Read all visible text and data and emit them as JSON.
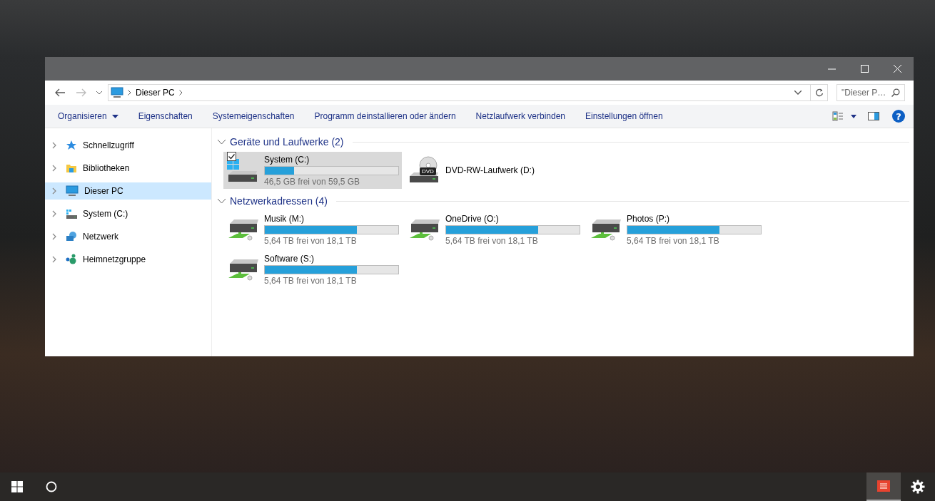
{
  "address_bar": {
    "path": [
      "Dieser PC"
    ],
    "search": {
      "placeholder": "\"Dieser P…"
    }
  },
  "help_button": {
    "label": "?"
  },
  "toolbar": {
    "items": [
      {
        "label": "Organisieren",
        "dropdown": true
      },
      {
        "label": "Eigenschaften",
        "dropdown": false
      },
      {
        "label": "Systemeigenschaften",
        "dropdown": false
      },
      {
        "label": "Programm deinstallieren oder ändern",
        "dropdown": false
      },
      {
        "label": "Netzlaufwerk verbinden",
        "dropdown": false
      },
      {
        "label": "Einstellungen öffnen",
        "dropdown": false
      }
    ]
  },
  "sidebar": {
    "items": [
      {
        "label": "Schnellzugriff",
        "kind": "star",
        "selected": false
      },
      {
        "label": "Bibliotheken",
        "kind": "library",
        "selected": false
      },
      {
        "label": "Dieser PC",
        "kind": "pc",
        "selected": true
      },
      {
        "label": "System (C:)",
        "kind": "disk",
        "selected": false
      },
      {
        "label": "Netzwerk",
        "kind": "network",
        "selected": false
      },
      {
        "label": "Heimnetzgruppe",
        "kind": "homegroup",
        "selected": false
      }
    ]
  },
  "groups": [
    {
      "title": "Geräte und Laufwerke (2)",
      "expanded": true,
      "items": [
        {
          "kind": "system",
          "name": "System (C:)",
          "level": 0.22,
          "free": "46,5 GB frei von 59,5 GB",
          "selected": true,
          "checked": true
        },
        {
          "kind": "dvd",
          "name": "DVD-RW-Laufwerk (D:)",
          "badge": "DVD",
          "selected": false,
          "checked": false
        }
      ]
    },
    {
      "title": "Netzwerkadressen (4)",
      "expanded": true,
      "items": [
        {
          "kind": "network",
          "name": "Musik (M:)",
          "level": 0.69,
          "free": "5,64 TB frei von 18,1 TB",
          "selected": false,
          "checked": false
        },
        {
          "kind": "network",
          "name": "OneDrive (O:)",
          "level": 0.69,
          "free": "5,64 TB frei von 18,1 TB",
          "selected": false,
          "checked": false
        },
        {
          "kind": "network",
          "name": "Photos (P:)",
          "level": 0.69,
          "free": "5,64 TB frei von 18,1 TB",
          "selected": false,
          "checked": false
        },
        {
          "kind": "network",
          "name": "Software (S:)",
          "level": 0.69,
          "free": "5,64 TB frei von 18,1 TB",
          "selected": false,
          "checked": false
        }
      ]
    }
  ]
}
